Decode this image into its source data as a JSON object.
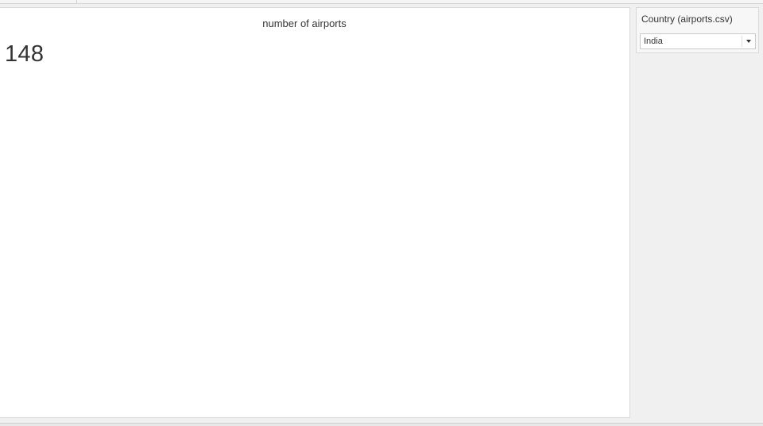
{
  "viz": {
    "title": "number of airports",
    "value": "148"
  },
  "filter": {
    "title": "Country (airports.csv)",
    "selected": "India"
  },
  "icons": {
    "dropdown": "chevron-down-icon"
  }
}
